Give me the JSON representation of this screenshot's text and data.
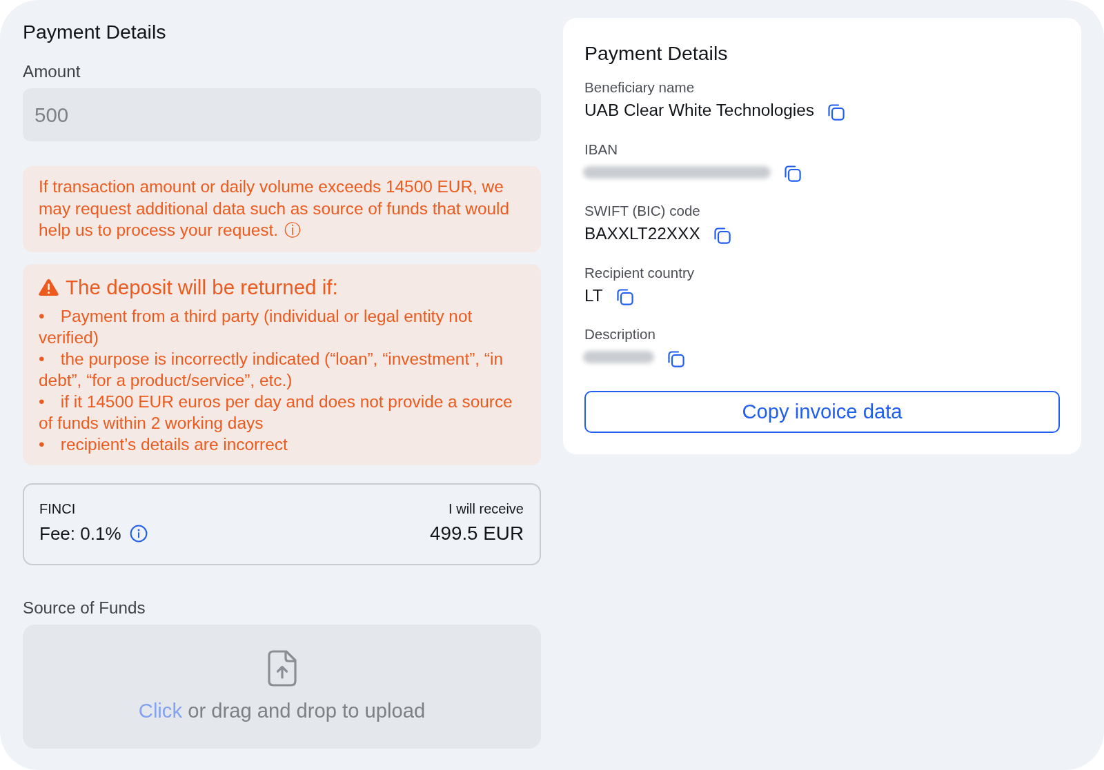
{
  "left": {
    "title": "Payment Details",
    "amount": {
      "label": "Amount",
      "value": "500",
      "disabled": true
    },
    "notice": {
      "text": "If transaction amount or daily volume exceeds 14500 EUR, we may request additional data such as source of funds that would help us to process your request.",
      "info_glyph": "ⓘ"
    },
    "warning": {
      "title": "The deposit will be returned if:",
      "items": [
        {
          "marker": "•",
          "text": "Payment from a third party (individual or legal entity not verified)"
        },
        {
          "marker": "•",
          "text": "the purpose is incorrectly indicated (“loan”, “investment”, “in debt”, “for a product/service”, etc.)"
        },
        {
          "marker": "•",
          "text": "if it 14500 EUR euros per day and does not provide a source of funds within 2 working days"
        },
        {
          "marker": "•",
          "text": "recipient’s details are incorrect"
        }
      ]
    },
    "fee": {
      "provider": "FINCI",
      "fee": "Fee: 0.1%",
      "receive_label": "I will receive",
      "receive_amount": "499.5 EUR"
    },
    "source": {
      "label": "Source of Funds",
      "link": "Click",
      "text": "or drag and drop to upload"
    }
  },
  "right": {
    "title": "Payment Details",
    "fields": [
      {
        "label": "Beneficiary name",
        "value": "UAB Clear White Technologies",
        "blurred": false
      },
      {
        "label": "IBAN",
        "blurred": true
      },
      {
        "label": "SWIFT (BIC) code",
        "value": "BAXXLT22XXX",
        "blurred": false
      },
      {
        "label": "Recipient country",
        "value": "LT",
        "blurred": false
      },
      {
        "label": "Description",
        "blurred": true
      }
    ],
    "button": "Copy invoice data"
  }
}
